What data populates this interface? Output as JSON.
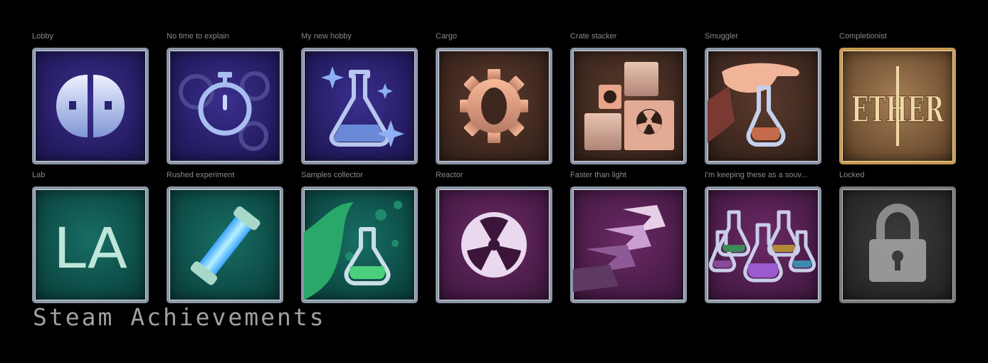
{
  "page_title": "Steam Achievements",
  "achievements": [
    {
      "label": "Lobby",
      "icon": "lobby-mask-icon"
    },
    {
      "label": "No time to explain",
      "icon": "stopwatch-icon"
    },
    {
      "label": "My new hobby",
      "icon": "flask-sparkles-icon"
    },
    {
      "label": "Cargo",
      "icon": "gear-ring-icon"
    },
    {
      "label": "Crate stacker",
      "icon": "radioactive-crates-icon"
    },
    {
      "label": "Smuggler",
      "icon": "hand-flask-icon"
    },
    {
      "label": "Completionist",
      "icon": "ether-logo-icon"
    },
    {
      "label": "Lab",
      "icon": "lab-logo-icon"
    },
    {
      "label": "Rushed experiment",
      "icon": "glowing-tube-icon"
    },
    {
      "label": "Samples collector",
      "icon": "bubbling-flask-icon"
    },
    {
      "label": "Reactor",
      "icon": "radiation-icon"
    },
    {
      "label": "Faster than light",
      "icon": "chevrons-icon"
    },
    {
      "label": "I'm keeping these as a souv...",
      "icon": "flask-collection-icon"
    },
    {
      "label": "Locked",
      "icon": "lock-icon"
    }
  ],
  "ether_text": "ETHER",
  "lab_text": "LA"
}
